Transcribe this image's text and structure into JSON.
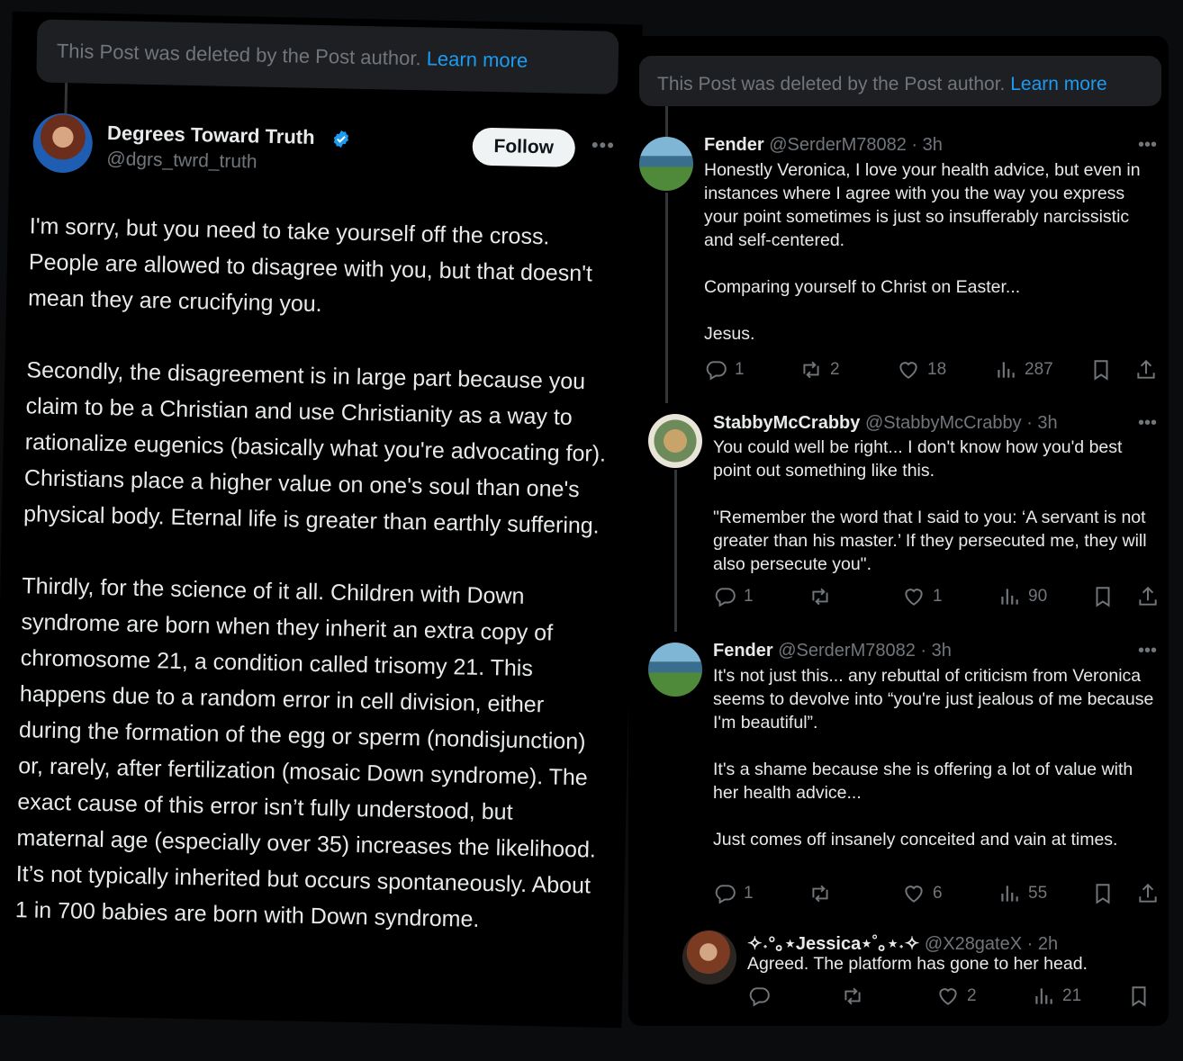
{
  "colors": {
    "accent": "#1d9bf0",
    "muted": "#71767b",
    "text": "#e7e9ea"
  },
  "left": {
    "deleted_text": "This Post was deleted by the Post author.",
    "learn_more": "Learn more",
    "author": {
      "name": "Degrees Toward Truth",
      "handle": "@dgrs_twrd_truth",
      "verified_icon": "verified-badge-icon"
    },
    "follow_label": "Follow",
    "more_icon": "more-options-icon",
    "body": "I'm sorry, but you need to take yourself off the cross. People are allowed to disagree with you, but that doesn't mean they are crucifying you.\n\nSecondly, the disagreement is in large part because you claim to be a Christian and use Christianity as a way to rationalize eugenics (basically what you're advocating for). Christians place a higher value on one's soul than one's physical body. Eternal life is greater than earthly suffering.\n\nThirdly, for the science of it all. Children with Down syndrome are born when they inherit an extra copy of chromosome 21, a condition called trisomy 21. This happens due to a random error in cell division, either during the formation of the egg or sperm (nondisjunction) or, rarely, after fertilization (mosaic Down syndrome). The exact cause of this error isn’t fully understood, but maternal age (especially over 35) increases the likelihood. It’s not typically inherited but occurs spontaneously. About 1 in 700 babies are born with Down syndrome."
  },
  "right": {
    "deleted_text": "This Post was deleted by the Post author.",
    "learn_more": "Learn more",
    "replies": [
      {
        "name": "Fender",
        "handle": "@SerderM78082 · 3h",
        "text": "Honestly Veronica, I love your health advice, but even in instances where I agree with you the way you express your point sometimes is just so insufferably narcissistic and self-centered.\n\nComparing yourself to Christ on Easter...\n\nJesus.",
        "replies": "1",
        "reposts": "2",
        "likes": "18",
        "views": "287"
      },
      {
        "name": "StabbyMcCrabby",
        "handle": "@StabbyMcCrabby · 3h",
        "text": "You could well be right... I don't know how you'd best point out something like this.\n\n\"Remember the word that I said to you: ‘A servant is not greater than his master.’ If they persecuted me, they will also persecute you\".",
        "replies": "1",
        "reposts": "",
        "likes": "1",
        "views": "90"
      },
      {
        "name": "Fender",
        "handle": "@SerderM78082 · 3h",
        "text": "It's not just this... any rebuttal of criticism from Veronica seems to devolve into “you're just jealous of me because I'm beautiful”.\n\nIt's a shame because she is offering a lot of value with her health advice...\n\nJust comes off insanely conceited and vain at times.",
        "replies": "1",
        "reposts": "",
        "likes": "6",
        "views": "55"
      },
      {
        "name": "✧˖°｡⋆Jessica⋆˚｡⋆˖✧",
        "handle": "@X28gateX · 2h",
        "text": "Agreed. The platform has gone to her head.",
        "replies": "",
        "reposts": "",
        "likes": "2",
        "views": "21"
      }
    ],
    "icons": [
      "reply-icon",
      "repost-icon",
      "like-icon",
      "views-icon",
      "bookmark-icon",
      "share-icon"
    ]
  }
}
